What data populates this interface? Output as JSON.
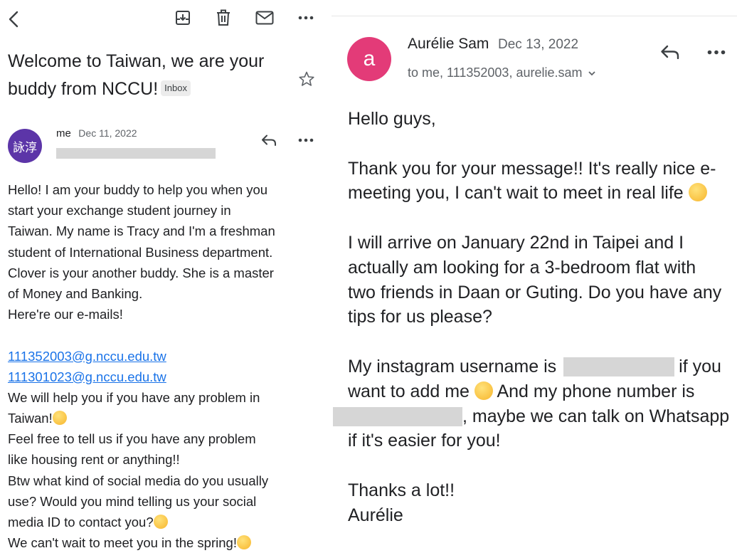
{
  "left": {
    "toolbar": {
      "back": "back-arrow",
      "archive": "archive",
      "delete": "trash",
      "unread": "mail",
      "more": "more"
    },
    "subject": "Welcome to Taiwan, we are your buddy from NCCU!",
    "label": "Inbox",
    "sender": {
      "avatar_text": "詠淳",
      "name": "me",
      "date": "Dec 11, 2022"
    },
    "body": {
      "p1": [
        "Hello! I am your buddy to help you when you",
        "start your exchange student journey in",
        "Taiwan. My name is Tracy and I'm a freshman",
        "student of International Business department.",
        "Clover is your another buddy. She is a master",
        "of Money and Banking.",
        "Here're our e-mails!"
      ],
      "email1": "111352003@g.nccu.edu.tw",
      "email2": "111301023@g.nccu.edu.tw",
      "p2": [
        "We will help you if you have any problem in",
        "Taiwan!",
        "Feel free to tell us if you have any problem",
        "like housing rent or anything!!",
        "Btw what kind of social media do you usually",
        "use? Would you mind telling us your social",
        "media  ID to contact you?",
        "We can't wait to meet you in the spring!"
      ]
    }
  },
  "right": {
    "sender": {
      "avatar_text": "a",
      "name": "Aurélie Sam",
      "date": "Dec 13, 2022",
      "to": "to me, 111352003, aurelie.sam"
    },
    "body": {
      "greeting": "Hello guys,",
      "p1": [
        "Thank you for your message!! It's really nice e-",
        "meeting you, I can't wait to meet in real life"
      ],
      "p2": [
        "I will arrive on January 22nd in Taipei and I",
        "actually am looking for a 3-bedroom flat with",
        "two friends in Daan or Guting. Do you have any",
        "tips for us please?"
      ],
      "p3_a": "My instagram username is",
      "p3_b": "if you",
      "p3_c": "want to add me",
      "p3_d": "And my phone number is",
      "p3_e": ", maybe we can talk on Whatsapp",
      "p3_f": "if it's easier for you!",
      "closing": "Thanks a lot!!",
      "signature": "Aurélie"
    }
  },
  "colors": {
    "link": "#1a73e8",
    "avatar_left": "#5c35a8",
    "avatar_right": "#e33b78",
    "label_bg": "#ececec"
  }
}
